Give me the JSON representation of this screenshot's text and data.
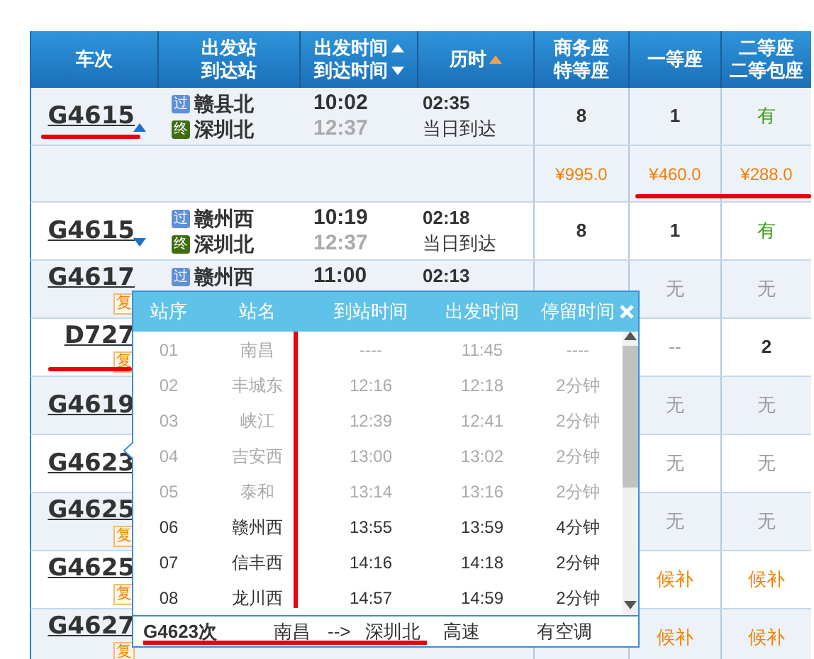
{
  "header": [
    {
      "lines": [
        "车次"
      ],
      "sortable": false
    },
    {
      "lines": [
        "出发站",
        "到达站"
      ],
      "sortable": false
    },
    {
      "lines": [
        "出发时间",
        "到达时间"
      ],
      "sortable": true,
      "sorted": false
    },
    {
      "lines": [
        "历时"
      ],
      "sortable": true,
      "sorted": true
    },
    {
      "lines": [
        "商务座",
        "特等座"
      ],
      "sortable": false
    },
    {
      "lines": [
        "一等座"
      ],
      "sortable": false
    },
    {
      "lines": [
        "二等座",
        "二等包座"
      ],
      "sortable": false
    }
  ],
  "rows": [
    {
      "train": "G4615",
      "marked": true,
      "expanded": true,
      "from": {
        "tag": "过",
        "kind": "pass",
        "name": "赣县北"
      },
      "to": {
        "tag": "终",
        "kind": "end",
        "name": "深圳北"
      },
      "depart": "10:02",
      "arrive": "12:37",
      "duration": "02:35",
      "note": "当日到达",
      "seats": {
        "business": {
          "text": "8",
          "kind": "count"
        },
        "first": {
          "text": "1",
          "kind": "count"
        },
        "second": {
          "text": "有",
          "kind": "available"
        }
      },
      "prices": {
        "marked": true,
        "business": "¥995.0",
        "first": "¥460.0",
        "second": "¥288.0"
      }
    },
    {
      "train": "G4615",
      "marked": false,
      "expanded": false,
      "from": {
        "tag": "过",
        "kind": "pass",
        "name": "赣州西"
      },
      "to": {
        "tag": "终",
        "kind": "end",
        "name": "深圳北"
      },
      "depart": "10:19",
      "arrive": "12:37",
      "duration": "02:18",
      "note": "当日到达",
      "seats": {
        "business": {
          "text": "8",
          "kind": "count"
        },
        "first": {
          "text": "1",
          "kind": "count"
        },
        "second": {
          "text": "有",
          "kind": "available"
        }
      }
    },
    {
      "train": "G4617",
      "marked": false,
      "badge": "复",
      "from": {
        "tag": "过",
        "kind": "pass",
        "name": "赣州西"
      },
      "depart": "11:00",
      "duration": "02:13",
      "seats": {
        "first": {
          "text": "无",
          "kind": "none"
        },
        "second": {
          "text": "无",
          "kind": "none"
        }
      }
    },
    {
      "train": "D727",
      "marked": true,
      "badge": "复",
      "seats": {
        "first": {
          "text": "--",
          "kind": "none"
        },
        "second": {
          "text": "2",
          "kind": "count"
        }
      }
    },
    {
      "train": "G4619",
      "marked": false,
      "seats": {
        "first": {
          "text": "无",
          "kind": "none"
        },
        "second": {
          "text": "无",
          "kind": "none"
        }
      }
    },
    {
      "train": "G4623",
      "marked": false,
      "seats": {
        "first": {
          "text": "无",
          "kind": "none"
        },
        "second": {
          "text": "无",
          "kind": "none"
        }
      }
    },
    {
      "train": "G4625",
      "marked": false,
      "badge": "复",
      "seats": {
        "first": {
          "text": "无",
          "kind": "none"
        },
        "second": {
          "text": "无",
          "kind": "none"
        }
      }
    },
    {
      "train": "G4625",
      "marked": false,
      "badge": "复",
      "seats": {
        "first": {
          "text": "候补",
          "kind": "waitlist"
        },
        "second": {
          "text": "候补",
          "kind": "waitlist"
        }
      }
    },
    {
      "train": "G4627",
      "marked": false,
      "badge": "复",
      "seats": {
        "first": {
          "text": "候补",
          "kind": "waitlist"
        },
        "second": {
          "text": "候补",
          "kind": "waitlist"
        }
      }
    }
  ],
  "popup": {
    "marked": true,
    "columns": [
      "站序",
      "站名",
      "到站时间",
      "出发时间",
      "停留时间"
    ],
    "stops": [
      {
        "seq": "01",
        "station": "南昌",
        "arrive": "----",
        "depart": "11:45",
        "stay": "----",
        "passed": true
      },
      {
        "seq": "02",
        "station": "丰城东",
        "arrive": "12:16",
        "depart": "12:18",
        "stay": "2分钟",
        "passed": true
      },
      {
        "seq": "03",
        "station": "峡江",
        "arrive": "12:39",
        "depart": "12:41",
        "stay": "2分钟",
        "passed": true
      },
      {
        "seq": "04",
        "station": "吉安西",
        "arrive": "13:00",
        "depart": "13:02",
        "stay": "2分钟",
        "passed": true
      },
      {
        "seq": "05",
        "station": "泰和",
        "arrive": "13:14",
        "depart": "13:16",
        "stay": "2分钟",
        "passed": true
      },
      {
        "seq": "06",
        "station": "赣州西",
        "arrive": "13:55",
        "depart": "13:59",
        "stay": "4分钟",
        "passed": false
      },
      {
        "seq": "07",
        "station": "信丰西",
        "arrive": "14:16",
        "depart": "14:18",
        "stay": "2分钟",
        "passed": false
      },
      {
        "seq": "08",
        "station": "龙川西",
        "arrive": "14:57",
        "depart": "14:59",
        "stay": "2分钟",
        "passed": false
      }
    ],
    "footer": {
      "train": "G4623次",
      "from": "南昌",
      "arrow": "-->",
      "to": "深圳北",
      "type": "高速",
      "extra": "有空调"
    }
  }
}
